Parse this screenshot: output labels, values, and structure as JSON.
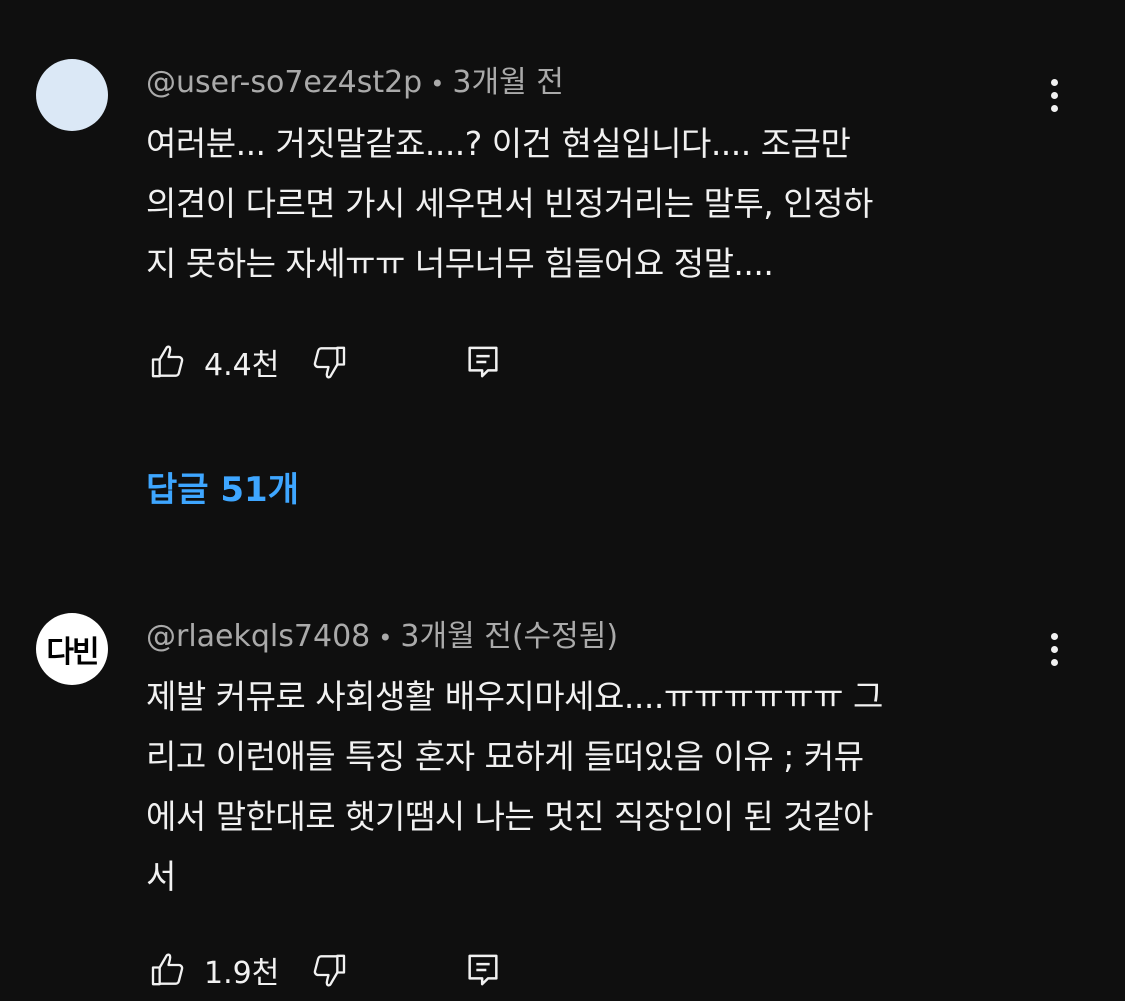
{
  "comments": [
    {
      "author": "@user-so7ez4st2p",
      "time": "3개월 전",
      "text": "여러분... 거짓말같죠....? 이건 현실입니다.... 조금만\n의견이 다르면 가시 세우면서 빈정거리는 말투, 인정하\n지 못하는 자세ㅠㅠ 너무너무 힘들어요 정말....",
      "likes": "4.4천",
      "replies_label": "답글 51개"
    },
    {
      "author": "@rlaekqls7408",
      "time": "3개월 전(수정됨)",
      "avatar_text": "다빈",
      "text": "제발 커뮤로 사회생활 배우지마세요....ㅠㅠㅠㅠㅠㅠ 그\n리고 이런애들 특징 혼자 묘하게 들떠있음 이유 ; 커뮤\n에서 말한대로 햇기땜시 나는 멋진 직장인이 된 것같아\n서",
      "likes": "1.9천"
    }
  ],
  "separator": "•",
  "colors": {
    "background": "#0f0f0f",
    "text": "#f1f1f1",
    "meta": "#aaaaaa",
    "link": "#3ea6ff",
    "avatar1": "#dbe8f6"
  },
  "icons": [
    "more-vert-icon",
    "thumb-up-icon",
    "thumb-down-icon",
    "reply-icon"
  ]
}
